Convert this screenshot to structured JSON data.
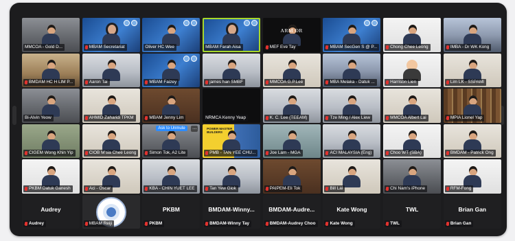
{
  "meeting": {
    "participants": [
      {
        "label": "MMCOA - Gold D...",
        "bg": "bg-room",
        "person": "hair",
        "muted": false
      },
      {
        "label": "MBAM Secretariat",
        "bg": "bg-blue",
        "person": "hijab",
        "muted": true
      },
      {
        "label": "Oliver HC Wee",
        "bg": "bg-blue",
        "person": "hair",
        "muted": false
      },
      {
        "label": "MBAM Farah Aisa",
        "bg": "bg-blue",
        "person": "hijab",
        "muted": false,
        "active": true
      },
      {
        "label": "MEF Eve Tay",
        "bg": "bg-black",
        "person": "hair",
        "muted": true,
        "overlay": "ARM    OR"
      },
      {
        "label": "MBAM SecGen S @ P...",
        "bg": "bg-blue",
        "person": "hair",
        "muted": true
      },
      {
        "label": "Chong Chee Leong",
        "bg": "bg-white",
        "person": "hair",
        "muted": true
      },
      {
        "label": "IMBA - Dr WK Kong",
        "bg": "bg-city",
        "person": "hair",
        "muted": true
      },
      {
        "label": "BMDAM HC H LIM P...",
        "bg": "bg-warm",
        "person": "hair",
        "muted": true
      },
      {
        "label": "Aaron Tai",
        "bg": "bg-office",
        "person": "hair",
        "muted": true
      },
      {
        "label": "MBAM Faizey",
        "bg": "bg-blue",
        "person": "hair",
        "muted": true
      },
      {
        "label": "james han SMBF",
        "bg": "bg-office",
        "person": "hair",
        "muted": true
      },
      {
        "label": "MMCOA G.P.Lee",
        "bg": "bg-wall",
        "person": "hair",
        "muted": true
      },
      {
        "label": "MBA Melaka - Datuk ...",
        "bg": "bg-city",
        "person": "hair",
        "muted": true
      },
      {
        "label": "Harrison Lien",
        "bg": "bg-white",
        "person": "avatar-cartoon",
        "muted": true
      },
      {
        "label": "Lim LK - SSPAMI",
        "bg": "bg-wall",
        "person": "hair",
        "muted": true
      },
      {
        "label": "Bi-Alvin Yeow",
        "bg": "bg-room",
        "person": "hair",
        "muted": false
      },
      {
        "label": "AHMID Zaharidi TPKM",
        "bg": "bg-wall",
        "person": "hair",
        "muted": true
      },
      {
        "label": "MBAM Jenny Lim",
        "bg": "bg-brown",
        "person": "hair",
        "muted": true
      },
      {
        "label": "NRMCA Kenny Yeap",
        "bg": "bg-black",
        "person": "none",
        "muted": false
      },
      {
        "label": "K. C. Lee (TEEAM)",
        "bg": "bg-office",
        "person": "hair",
        "muted": true
      },
      {
        "label": "Tze Ming / Alex Liew",
        "bg": "bg-office",
        "person": "hair",
        "muted": true
      },
      {
        "label": "MMCOA Albert Lai",
        "bg": "bg-wall",
        "person": "hair",
        "muted": true
      },
      {
        "label": "MPIA Lionel Yap",
        "bg": "bg-shelf",
        "person": "hair",
        "muted": true
      },
      {
        "label": "CIGEM Wong Khin Yip",
        "bg": "bg-green",
        "person": "hair",
        "muted": true
      },
      {
        "label": "CIOB M'sia Chee Leong",
        "bg": "bg-wall",
        "person": "hair",
        "muted": true
      },
      {
        "label": "Simon Tok, A2 Lite",
        "bg": "bg-room",
        "person": "hair",
        "muted": true,
        "tooltip": "Ask to Unmute"
      },
      {
        "label": "PMB - TAN YEE CHU...",
        "bg": "bg-yellow",
        "person": "hair",
        "muted": true,
        "yellow": "POWER MASTER BUILDERS"
      },
      {
        "label": "Joe Lam - MGA",
        "bg": "bg-teal",
        "person": "hair",
        "muted": true
      },
      {
        "label": "ACI MALAYSIA (Eng)",
        "bg": "bg-office",
        "person": "hair",
        "muted": true
      },
      {
        "label": "Choo WT (SBA)",
        "bg": "bg-white",
        "person": "hair",
        "muted": true
      },
      {
        "label": "BMDAM - Patrick Ong",
        "bg": "bg-wall",
        "person": "hair",
        "muted": true
      },
      {
        "label": "PKBM Datuk Ganesh",
        "bg": "bg-white",
        "person": "hair",
        "muted": true
      },
      {
        "label": "Aci - Oscar",
        "bg": "bg-wall",
        "person": "hair",
        "muted": true
      },
      {
        "label": "KBA - CHIN YUET LEE",
        "bg": "bg-office",
        "person": "hair",
        "muted": true
      },
      {
        "label": "Tan Yew Giok",
        "bg": "bg-office",
        "person": "hair",
        "muted": true
      },
      {
        "label": "PAIPEM-Eli Tok",
        "bg": "bg-brown",
        "person": "hair",
        "muted": true
      },
      {
        "label": "Bill Lai",
        "bg": "bg-wall",
        "person": "hair",
        "muted": true
      },
      {
        "label": "Chi Nam's iPhone",
        "bg": "bg-room",
        "person": "hair",
        "muted": true
      },
      {
        "label": "RFM-Fong",
        "bg": "bg-white",
        "person": "hair",
        "muted": true
      },
      {
        "label": "Audrey",
        "big": "Audrey",
        "muted": true,
        "nameonly": true
      },
      {
        "label": "MBAM Reiji",
        "bg": "bg-dark",
        "person": "logo",
        "muted": true
      },
      {
        "label": "PKBM",
        "big": "PKBM",
        "muted": true,
        "nameonly": true
      },
      {
        "label": "BMDAM-Winny Tay",
        "big": "BMDAM-Winny...",
        "muted": true,
        "nameonly": true
      },
      {
        "label": "BMDAM-Audrey Choo",
        "big": "BMDAM-Audre...",
        "muted": true,
        "nameonly": true
      },
      {
        "label": "Kate Wong",
        "big": "Kate Wong",
        "muted": true,
        "nameonly": true
      },
      {
        "label": "TWL",
        "big": "TWL",
        "muted": true,
        "nameonly": true
      },
      {
        "label": "Brian Gan",
        "big": "Brian Gan",
        "muted": true,
        "nameonly": true
      }
    ]
  }
}
